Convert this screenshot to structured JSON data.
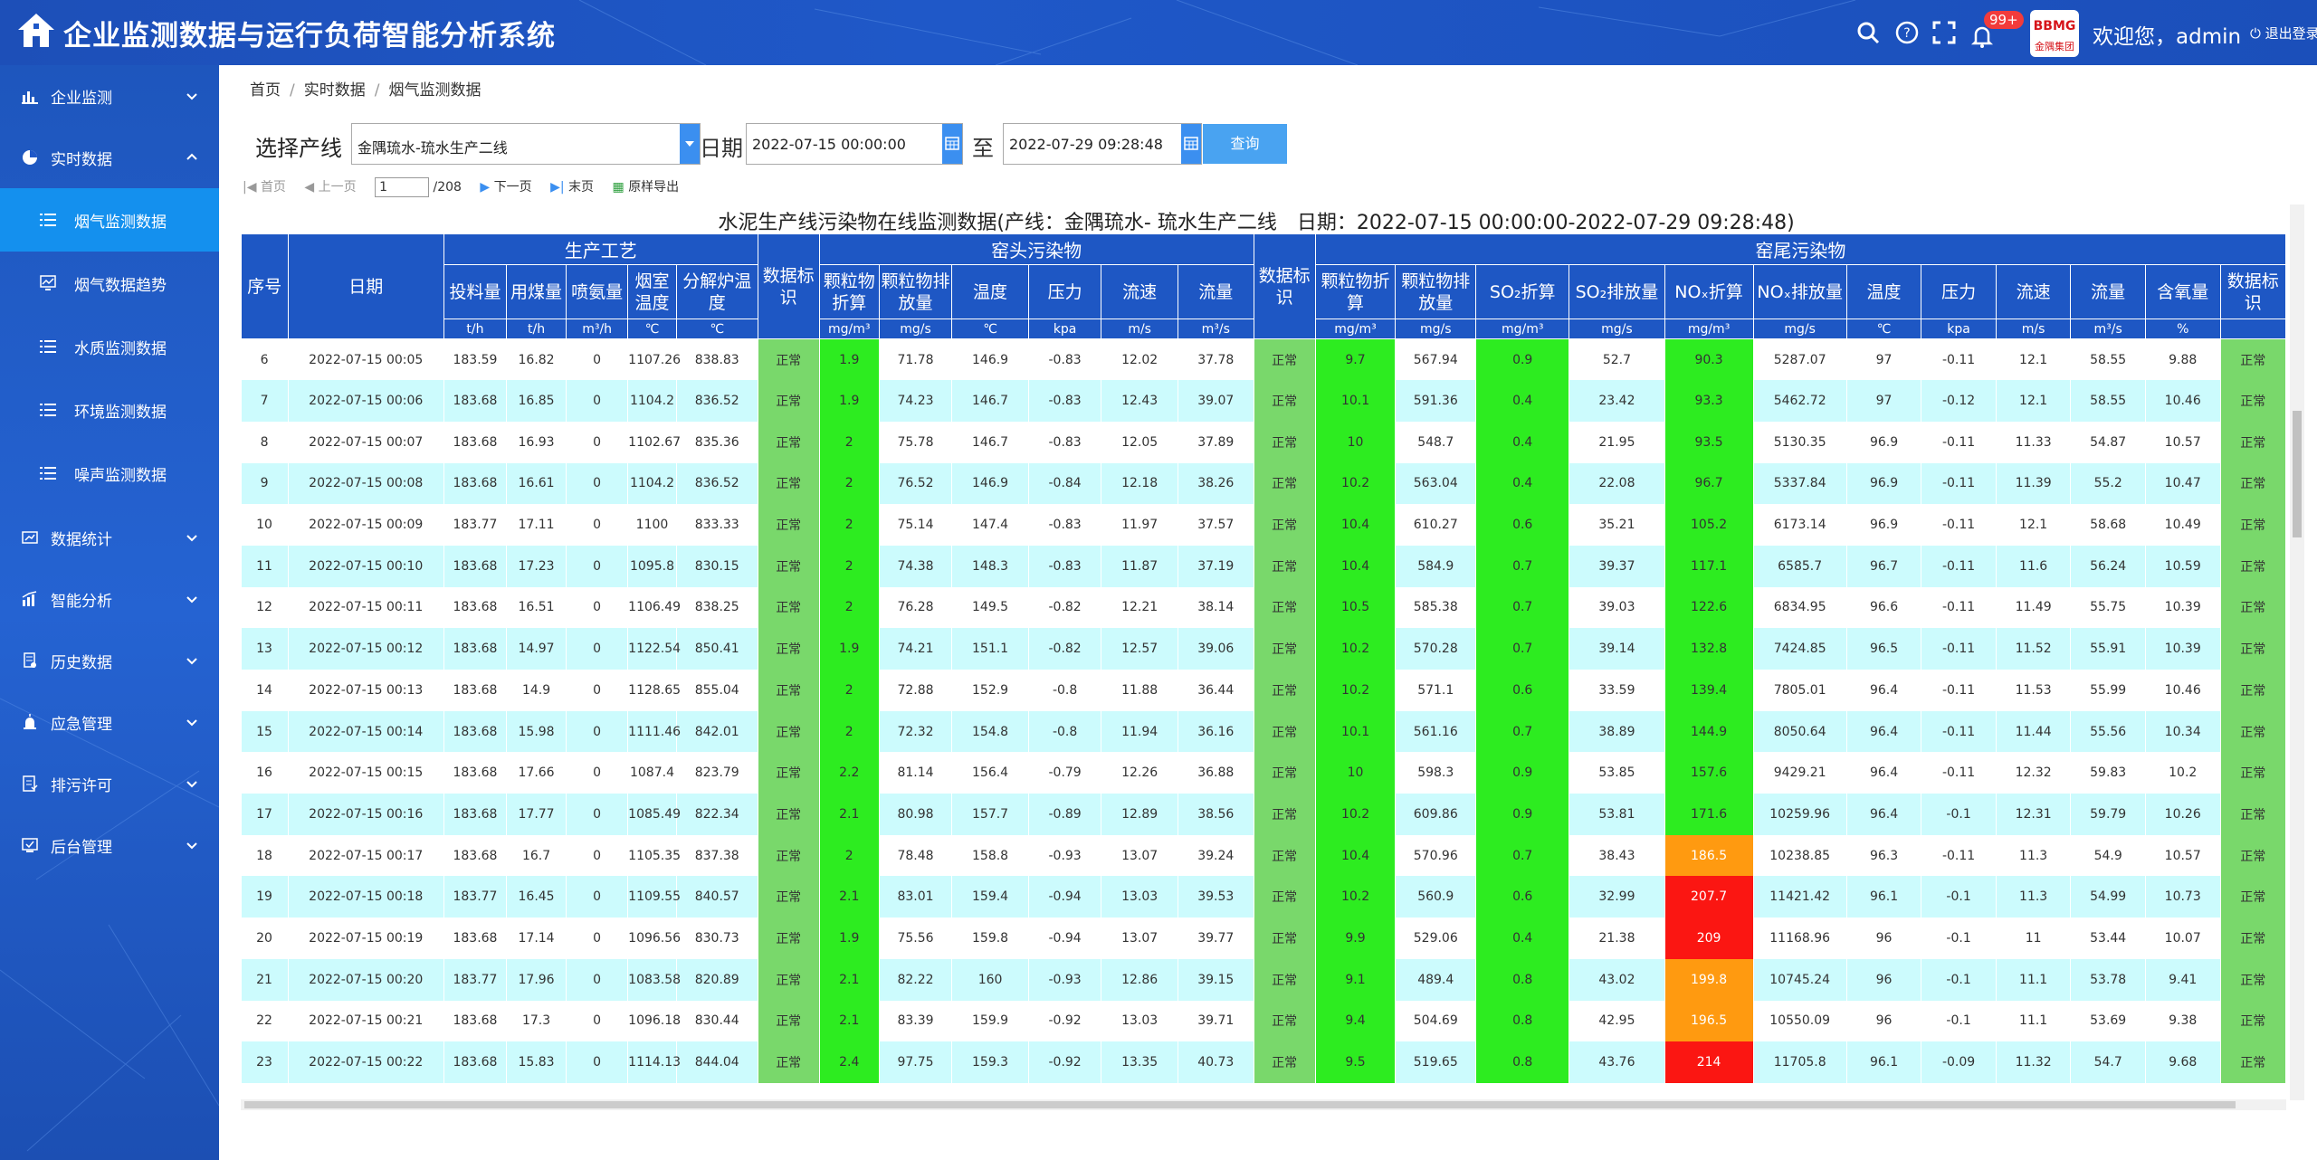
{
  "header": {
    "title": "企业监测数据与运行负荷智能分析系统",
    "badge": "99+",
    "welcome": "欢迎您，admin",
    "logout": "退出登录",
    "brand_text": "BBMG",
    "brand_sub": "金隅集团"
  },
  "sidebar": {
    "items": [
      {
        "label": "企业监测"
      },
      {
        "label": "实时数据"
      },
      {
        "label": "数据统计"
      },
      {
        "label": "智能分析"
      },
      {
        "label": "历史数据"
      },
      {
        "label": "应急管理"
      },
      {
        "label": "排污许可"
      },
      {
        "label": "后台管理"
      }
    ],
    "sub_items": [
      {
        "label": "烟气监测数据"
      },
      {
        "label": "烟气数据趋势"
      },
      {
        "label": "水质监测数据"
      },
      {
        "label": "环境监测数据"
      },
      {
        "label": "噪声监测数据"
      }
    ]
  },
  "breadcrumb": [
    "首页",
    "实时数据",
    "烟气监测数据"
  ],
  "filter": {
    "line_label": "选择产线",
    "line_value": "金隅琉水-琉水生产二线",
    "date_label": "日期",
    "start_date": "2022-07-15 00:00:00",
    "to_label": "至",
    "end_date": "2022-07-29 09:28:48",
    "query_button": "查询"
  },
  "pager": {
    "first": "首页",
    "prev": "上一页",
    "page": "1",
    "total": "/208",
    "next": "下一页",
    "last": "末页",
    "export": "原样导出"
  },
  "table": {
    "title": "水泥生产线污染物在线监测数据(产线：金隅琉水- 琉水生产二线　日期：2022-07-15 00:00:00-2022-07-29 09:28:48)",
    "groups": [
      "生产工艺",
      "窑头污染物",
      "窑尾污染物"
    ],
    "col_seq": "序号",
    "col_date": "日期",
    "headers": [
      "投料量",
      "用煤量",
      "喷氨量",
      "烟室温度",
      "分解炉温度",
      "数据标识",
      "颗粒物折算",
      "颗粒物排放量",
      "温度",
      "压力",
      "流速",
      "流量",
      "数据标识",
      "颗粒物折算",
      "颗粒物排放量",
      "SO₂折算",
      "SO₂排放量",
      "NOₓ折算",
      "NOₓ排放量",
      "温度",
      "压力",
      "流速",
      "流量",
      "含氧量",
      "数据标识"
    ],
    "units": [
      "t/h",
      "t/h",
      "m³/h",
      "℃",
      "℃",
      "",
      "mg/m³",
      "mg/s",
      "℃",
      "kpa",
      "m/s",
      "m³/s",
      "",
      "mg/m³",
      "mg/s",
      "mg/m³",
      "mg/s",
      "mg/m³",
      "mg/s",
      "℃",
      "kpa",
      "m/s",
      "m³/s",
      "%",
      ""
    ],
    "rows": [
      [
        "6",
        "2022-07-15 00:05",
        "183.59",
        "16.82",
        "0",
        "1107.26",
        "838.83",
        "正常",
        "1.9",
        "71.78",
        "146.9",
        "-0.83",
        "12.02",
        "37.78",
        "正常",
        "9.7",
        "567.94",
        "0.9",
        "52.7",
        "90.3",
        "5287.07",
        "97",
        "-0.11",
        "12.1",
        "58.55",
        "9.88",
        "正常"
      ],
      [
        "7",
        "2022-07-15 00:06",
        "183.68",
        "16.85",
        "0",
        "1104.2",
        "836.52",
        "正常",
        "1.9",
        "74.23",
        "146.7",
        "-0.83",
        "12.43",
        "39.07",
        "正常",
        "10.1",
        "591.36",
        "0.4",
        "23.42",
        "93.3",
        "5462.72",
        "97",
        "-0.12",
        "12.1",
        "58.55",
        "10.46",
        "正常"
      ],
      [
        "8",
        "2022-07-15 00:07",
        "183.68",
        "16.93",
        "0",
        "1102.67",
        "835.36",
        "正常",
        "2",
        "75.78",
        "146.7",
        "-0.83",
        "12.05",
        "37.89",
        "正常",
        "10",
        "548.7",
        "0.4",
        "21.95",
        "93.5",
        "5130.35",
        "96.9",
        "-0.11",
        "11.33",
        "54.87",
        "10.57",
        "正常"
      ],
      [
        "9",
        "2022-07-15 00:08",
        "183.68",
        "16.61",
        "0",
        "1104.2",
        "836.52",
        "正常",
        "2",
        "76.52",
        "146.9",
        "-0.84",
        "12.18",
        "38.26",
        "正常",
        "10.2",
        "563.04",
        "0.4",
        "22.08",
        "96.7",
        "5337.84",
        "96.9",
        "-0.11",
        "11.39",
        "55.2",
        "10.47",
        "正常"
      ],
      [
        "10",
        "2022-07-15 00:09",
        "183.77",
        "17.11",
        "0",
        "1100",
        "833.33",
        "正常",
        "2",
        "75.14",
        "147.4",
        "-0.83",
        "11.97",
        "37.57",
        "正常",
        "10.4",
        "610.27",
        "0.6",
        "35.21",
        "105.2",
        "6173.14",
        "96.9",
        "-0.11",
        "12.1",
        "58.68",
        "10.49",
        "正常"
      ],
      [
        "11",
        "2022-07-15 00:10",
        "183.68",
        "17.23",
        "0",
        "1095.8",
        "830.15",
        "正常",
        "2",
        "74.38",
        "148.3",
        "-0.83",
        "11.87",
        "37.19",
        "正常",
        "10.4",
        "584.9",
        "0.7",
        "39.37",
        "117.1",
        "6585.7",
        "96.7",
        "-0.11",
        "11.6",
        "56.24",
        "10.59",
        "正常"
      ],
      [
        "12",
        "2022-07-15 00:11",
        "183.68",
        "16.51",
        "0",
        "1106.49",
        "838.25",
        "正常",
        "2",
        "76.28",
        "149.5",
        "-0.82",
        "12.21",
        "38.14",
        "正常",
        "10.5",
        "585.38",
        "0.7",
        "39.03",
        "122.6",
        "6834.95",
        "96.6",
        "-0.11",
        "11.49",
        "55.75",
        "10.39",
        "正常"
      ],
      [
        "13",
        "2022-07-15 00:12",
        "183.68",
        "14.97",
        "0",
        "1122.54",
        "850.41",
        "正常",
        "1.9",
        "74.21",
        "151.1",
        "-0.82",
        "12.57",
        "39.06",
        "正常",
        "10.2",
        "570.28",
        "0.7",
        "39.14",
        "132.8",
        "7424.85",
        "96.5",
        "-0.11",
        "11.52",
        "55.91",
        "10.39",
        "正常"
      ],
      [
        "14",
        "2022-07-15 00:13",
        "183.68",
        "14.9",
        "0",
        "1128.65",
        "855.04",
        "正常",
        "2",
        "72.88",
        "152.9",
        "-0.8",
        "11.88",
        "36.44",
        "正常",
        "10.2",
        "571.1",
        "0.6",
        "33.59",
        "139.4",
        "7805.01",
        "96.4",
        "-0.11",
        "11.53",
        "55.99",
        "10.46",
        "正常"
      ],
      [
        "15",
        "2022-07-15 00:14",
        "183.68",
        "15.98",
        "0",
        "1111.46",
        "842.01",
        "正常",
        "2",
        "72.32",
        "154.8",
        "-0.8",
        "11.94",
        "36.16",
        "正常",
        "10.1",
        "561.16",
        "0.7",
        "38.89",
        "144.9",
        "8050.64",
        "96.4",
        "-0.11",
        "11.44",
        "55.56",
        "10.34",
        "正常"
      ],
      [
        "16",
        "2022-07-15 00:15",
        "183.68",
        "17.66",
        "0",
        "1087.4",
        "823.79",
        "正常",
        "2.2",
        "81.14",
        "156.4",
        "-0.79",
        "12.26",
        "36.88",
        "正常",
        "10",
        "598.3",
        "0.9",
        "53.85",
        "157.6",
        "9429.21",
        "96.4",
        "-0.11",
        "12.32",
        "59.83",
        "10.2",
        "正常"
      ],
      [
        "17",
        "2022-07-15 00:16",
        "183.68",
        "17.77",
        "0",
        "1085.49",
        "822.34",
        "正常",
        "2.1",
        "80.98",
        "157.7",
        "-0.89",
        "12.89",
        "38.56",
        "正常",
        "10.2",
        "609.86",
        "0.9",
        "53.81",
        "171.6",
        "10259.96",
        "96.4",
        "-0.1",
        "12.31",
        "59.79",
        "10.26",
        "正常"
      ],
      [
        "18",
        "2022-07-15 00:17",
        "183.68",
        "16.7",
        "0",
        "1105.35",
        "837.38",
        "正常",
        "2",
        "78.48",
        "158.8",
        "-0.93",
        "13.07",
        "39.24",
        "正常",
        "10.4",
        "570.96",
        "0.7",
        "38.43",
        "186.5",
        "10238.85",
        "96.3",
        "-0.11",
        "11.3",
        "54.9",
        "10.57",
        "正常"
      ],
      [
        "19",
        "2022-07-15 00:18",
        "183.77",
        "16.45",
        "0",
        "1109.55",
        "840.57",
        "正常",
        "2.1",
        "83.01",
        "159.4",
        "-0.94",
        "13.03",
        "39.53",
        "正常",
        "10.2",
        "560.9",
        "0.6",
        "32.99",
        "207.7",
        "11421.42",
        "96.1",
        "-0.1",
        "11.3",
        "54.99",
        "10.73",
        "正常"
      ],
      [
        "20",
        "2022-07-15 00:19",
        "183.68",
        "17.14",
        "0",
        "1096.56",
        "830.73",
        "正常",
        "1.9",
        "75.56",
        "159.8",
        "-0.94",
        "13.07",
        "39.77",
        "正常",
        "9.9",
        "529.06",
        "0.4",
        "21.38",
        "209",
        "11168.96",
        "96",
        "-0.1",
        "11",
        "53.44",
        "10.07",
        "正常"
      ],
      [
        "21",
        "2022-07-15 00:20",
        "183.77",
        "17.96",
        "0",
        "1083.58",
        "820.89",
        "正常",
        "2.1",
        "82.22",
        "160",
        "-0.93",
        "12.86",
        "39.15",
        "正常",
        "9.1",
        "489.4",
        "0.8",
        "43.02",
        "199.8",
        "10745.24",
        "96",
        "-0.1",
        "11.1",
        "53.78",
        "9.41",
        "正常"
      ],
      [
        "22",
        "2022-07-15 00:21",
        "183.68",
        "17.3",
        "0",
        "1096.18",
        "830.44",
        "正常",
        "2.1",
        "83.39",
        "159.9",
        "-0.92",
        "13.03",
        "39.71",
        "正常",
        "9.4",
        "504.69",
        "0.8",
        "42.95",
        "196.5",
        "10550.09",
        "96",
        "-0.1",
        "11.1",
        "53.69",
        "9.38",
        "正常"
      ],
      [
        "23",
        "2022-07-15 00:22",
        "183.68",
        "15.83",
        "0",
        "1114.13",
        "844.04",
        "正常",
        "2.4",
        "97.75",
        "159.3",
        "-0.92",
        "13.35",
        "40.73",
        "正常",
        "9.5",
        "519.65",
        "0.8",
        "43.76",
        "214",
        "11705.8",
        "96.1",
        "-0.09",
        "11.32",
        "54.7",
        "9.68",
        "正常"
      ]
    ],
    "nox_level": [
      "green",
      "green",
      "green",
      "green",
      "green",
      "green",
      "green",
      "green",
      "green",
      "green",
      "green",
      "green",
      "orange",
      "red",
      "red",
      "orange",
      "orange",
      "red"
    ]
  },
  "colors": {
    "header_blue": "#1e57c4",
    "status_green": "#79d86b",
    "value_green": "#2dec20",
    "warn_orange": "#ff9a10",
    "alarm_red": "#fb1612",
    "row_alt": "#ccfbfd",
    "active_menu": "#1490ee"
  }
}
